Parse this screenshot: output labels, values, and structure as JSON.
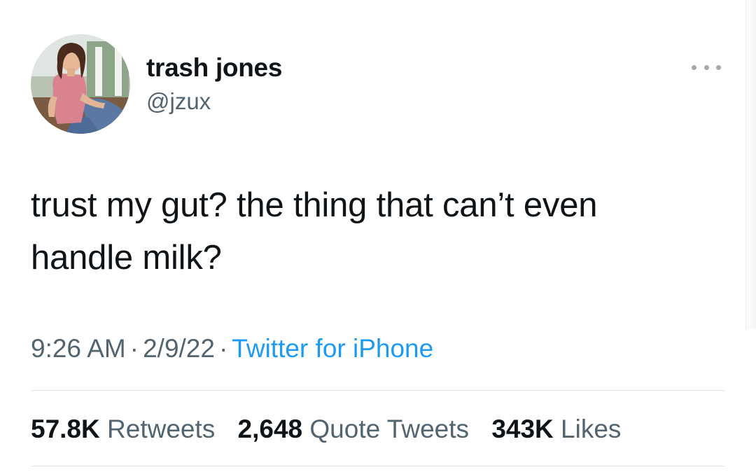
{
  "user": {
    "display_name": "trash jones",
    "handle": "@jzux"
  },
  "tweet": {
    "lines": [
      "trust my gut? the thing that can’t even",
      "handle milk?"
    ]
  },
  "meta": {
    "time": "9:26 AM",
    "separator": "·",
    "date": "2/9/22",
    "source": "Twitter for iPhone"
  },
  "stats": {
    "retweets_count": "57.8K",
    "retweets_label": "Retweets",
    "quote_count": "2,648",
    "quote_label": "Quote Tweets",
    "likes_count": "343K",
    "likes_label": "Likes"
  },
  "icons": {
    "more": "more-options-icon"
  },
  "colors": {
    "text": "#0f1419",
    "secondary": "#536471",
    "link": "#1d9bf0"
  }
}
